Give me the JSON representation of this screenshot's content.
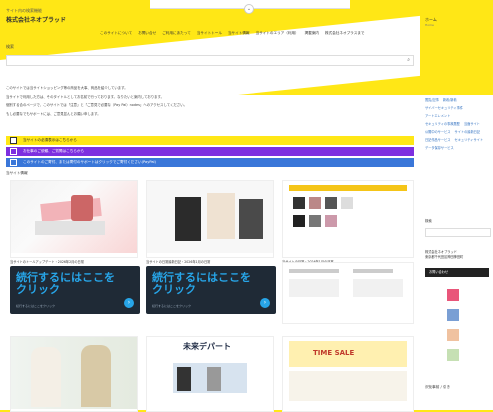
{
  "site": {
    "small": "サイト内の検索機能",
    "name": "株式会社ネオプラッド"
  },
  "nav": [
    "このサイトについて",
    "お問い合せ",
    "ご利用にあたって",
    "当サイトトール",
    "当サイト情報",
    "当サイトのエリア（利用）",
    "掲載案内",
    "株式会社ネオプラスまで"
  ],
  "search": {
    "label": "検索",
    "placeholder": ""
  },
  "info_lines": [
    "このサイトでは当サイトショッピング等の商品を大事、商品を紹介しています。",
    "当サイトで利用した方は、そのタイトルとしてお名前で行っております。なりたいと案内しております。",
    "個別する合のページで、このサイトでは「注意」と「ご意見で必要な（Pay Pal）nodes」へのアクセスしてください。",
    "もし必要なでもサポートには、ご意見並んとお願い申します。"
  ],
  "bars": [
    {
      "label": "当サイトの必須表示はこちらから"
    },
    {
      "label": "お仕事のご依頼、ご質問はこちらから"
    },
    {
      "label": "このサイトのご寄付、または寄付のサポートはクリックでご寄付ください(PayPal)"
    }
  ],
  "section_title": "当サイト情報",
  "cards_row1": [
    {
      "caption": "当サイトのトールアップデート・2026年2月の日常"
    },
    {
      "caption": "当サイトの日常最新日記・2026年1月の日常"
    },
    {
      "caption": "当サイトの日常・2026年1月の日常"
    }
  ],
  "ads": [
    {
      "title": "続行するにはここを\nクリック",
      "sub": "続行するにはここをクリック"
    },
    {
      "title": "続行するにはここを\nクリック",
      "sub": "続行するにはここをクリック"
    }
  ],
  "card_label_1": "未来デパート",
  "card_label_2": "TIME SALE",
  "right": {
    "home": "ホーム",
    "home_sub": "Home",
    "tabs": [
      "閲覧/記事",
      "新着/新着",
      "サイバーセキュリティ事件",
      "アートエレメント",
      "セキュリティの事故履歴",
      "当面サイト",
      "公開中のサービス",
      "サイトの最新日記",
      "日記作品サービス",
      "セキュリティサイト",
      "データ保存サービス"
    ],
    "search_label": "検索",
    "company": "株式会社ネオプラッド",
    "company_sub": "東京都千代田区神田神田町",
    "black_label": "お問い合わせ",
    "product": "沢化事前 / 引き"
  }
}
